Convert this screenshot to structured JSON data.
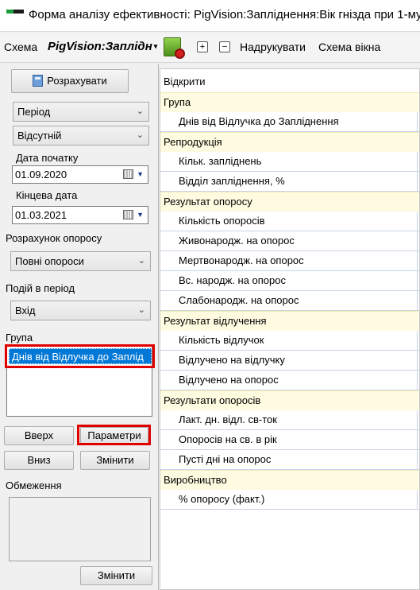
{
  "window": {
    "title": "Форма аналізу ефективності: PigVision:Запліднення:Вік гнізда при 1-му"
  },
  "toolbar": {
    "schema_label": "Схема",
    "report_name": "PigVision:Заплідн",
    "report_caret": "▾",
    "calc_icon": "calculate-report-icon",
    "expand_glyph": "+",
    "collapse_glyph": "−",
    "print_label": "Надрукувати",
    "window_schema_label": "Схема вікна"
  },
  "left": {
    "calculate_label": "Розрахувати",
    "period_select": "Період",
    "absent_select": "Відсутній",
    "start_date_label": "Дата початку",
    "start_date": "01.09.2020",
    "end_date_label": "Кінцева дата",
    "end_date": "01.03.2021",
    "farrow_calc_label": "Розрахунок опоросу",
    "farrow_calc_select": "Повні опороси",
    "events_label": "Подій в період",
    "events_select": "Вхід",
    "group_label": "Група",
    "group_items": [
      "Днів від Відлучка  до Заплід"
    ],
    "up_label": "Вверх",
    "params_label": "Параметри",
    "down_label": "Вниз",
    "change_label": "Змінити",
    "limits_label": "Обмеження",
    "change2_label": "Змінити"
  },
  "tree": {
    "open_label": "Відкрити",
    "rows": [
      {
        "type": "header",
        "label": "Група"
      },
      {
        "type": "item",
        "label": "Днів від Відлучка  до Запліднення"
      },
      {
        "type": "header",
        "label": "Репродукція"
      },
      {
        "type": "item",
        "label": "Кільк. запліднень"
      },
      {
        "type": "item",
        "label": "Відділ запліднення, %"
      },
      {
        "type": "header",
        "label": "Результат опоросу"
      },
      {
        "type": "item",
        "label": "Кількість опоросів"
      },
      {
        "type": "item",
        "label": "Живонародж. на опорос"
      },
      {
        "type": "item",
        "label": "Мертвонародж. на опорос"
      },
      {
        "type": "item",
        "label": "Вс. народж. на опорос"
      },
      {
        "type": "item",
        "label": "Слабонародж. на опорос"
      },
      {
        "type": "header",
        "label": "Результат відлучення"
      },
      {
        "type": "item",
        "label": "Кількість відлучок"
      },
      {
        "type": "item",
        "label": "Відлучено на відлучку"
      },
      {
        "type": "item",
        "label": "Відлучено на опорос"
      },
      {
        "type": "header",
        "label": "Результати опоросів"
      },
      {
        "type": "item",
        "label": "Лакт. дн. відл. св-ток"
      },
      {
        "type": "item",
        "label": "Опоросів на св. в рік"
      },
      {
        "type": "item",
        "label": "Пусті дні на опорос"
      },
      {
        "type": "header",
        "label": "Виробництво"
      },
      {
        "type": "item",
        "label": "% опоросу (факт.)"
      }
    ]
  },
  "colors": {
    "selection": "#0078d7",
    "highlight_border": "#e00000",
    "header_row_bg": "#fffbe0"
  }
}
